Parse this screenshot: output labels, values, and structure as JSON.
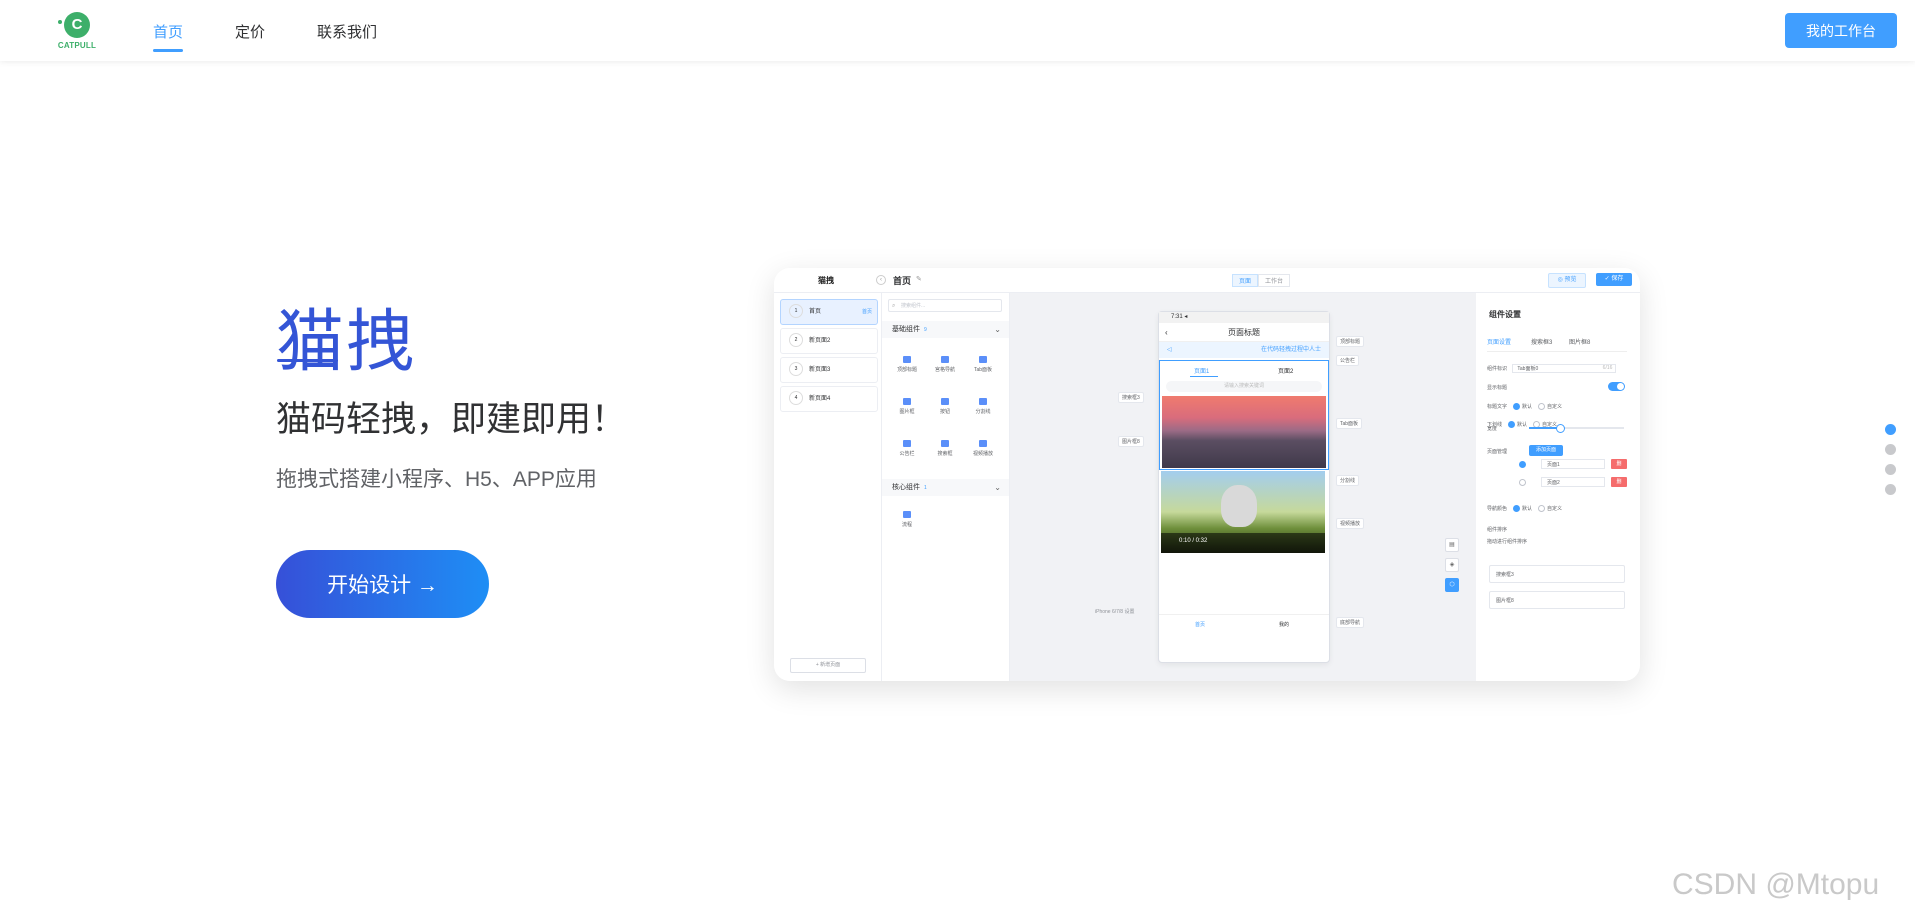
{
  "nav": {
    "logo_letter": "C",
    "logo_text": "CATPULL",
    "items": [
      {
        "label": "首页",
        "active": true
      },
      {
        "label": "定价",
        "active": false
      },
      {
        "label": "联系我们",
        "active": false
      }
    ],
    "workbench_label": "我的工作台"
  },
  "hero": {
    "title": "猫拽",
    "subtitle": "猫码轻拽，即建即用！",
    "description": "拖拽式搭建小程序、H5、APP应用",
    "start_button": "开始设计 →"
  },
  "mockup": {
    "logo": "猫拽",
    "page_title": "首页",
    "top_tabs": [
      "页面",
      "工作台"
    ],
    "preview_label": "◎ 预览",
    "save_label": "✓ 保存",
    "pages": [
      {
        "num": "1",
        "name": "首页",
        "tag": "首页"
      },
      {
        "num": "2",
        "name": "新页面2",
        "tag": ""
      },
      {
        "num": "3",
        "name": "新页面3",
        "tag": ""
      },
      {
        "num": "4",
        "name": "新页面4",
        "tag": ""
      }
    ],
    "add_page": "+ 新增页面",
    "component_search_placeholder": "搜索组件...",
    "basic_group": {
      "title": "基础组件",
      "count": "9"
    },
    "basic_components": [
      "顶部标题",
      "宫格导航",
      "Tab面板",
      "图片框",
      "按钮",
      "分割线",
      "公告栏",
      "搜索框",
      "视频播放"
    ],
    "core_group": {
      "title": "核心组件",
      "count": "1"
    },
    "core_components": [
      "流程"
    ],
    "phone": {
      "time": "7:31 ◂",
      "nav_title": "页面标题",
      "notice": "在代码轻拽过程中人士",
      "tabs": [
        "页面1",
        "页面2"
      ],
      "search_placeholder": "请输入搜索关键词",
      "video_time": "0:10 / 0:32",
      "tabbar": [
        "首页",
        "我的"
      ]
    },
    "canvas_labels": {
      "top_title": "顶部标题",
      "notice": "公告栏",
      "search": "搜索框3",
      "tab_panel": "Tab面板",
      "image": "图片框8",
      "divider": "分割线",
      "video": "视频播放",
      "bottom_nav": "底部导航"
    },
    "device_model": "iPhone 6/7/8 设置",
    "settings": {
      "title": "组件设置",
      "tabs": [
        "页面设置",
        "搜索框3",
        "图片框8"
      ],
      "component_id_label": "组件标识",
      "component_id_value": "Tab面板0",
      "component_id_count": "6/16",
      "show_title_label": "显示标题",
      "title_text_label": "标题文字",
      "underline_label": "下划线",
      "width_label": "宽度",
      "page_manage_label": "页面管理",
      "add_page_button": "添加页面",
      "page_inputs": [
        "页面1",
        "页面2"
      ],
      "delete_label": "删",
      "selected_color_label": "导航颜色",
      "option_default": "默认",
      "option_custom": "自定义",
      "order_label": "组件排序",
      "order_hint": "拖动进行组件排序",
      "order_items": [
        "搜索框3",
        "图片框8"
      ]
    }
  },
  "watermark": "CSDN @Mtopu",
  "colors": {
    "primary": "#409eff",
    "brand_green": "#3daf6a",
    "title_blue": "#3455d6"
  }
}
